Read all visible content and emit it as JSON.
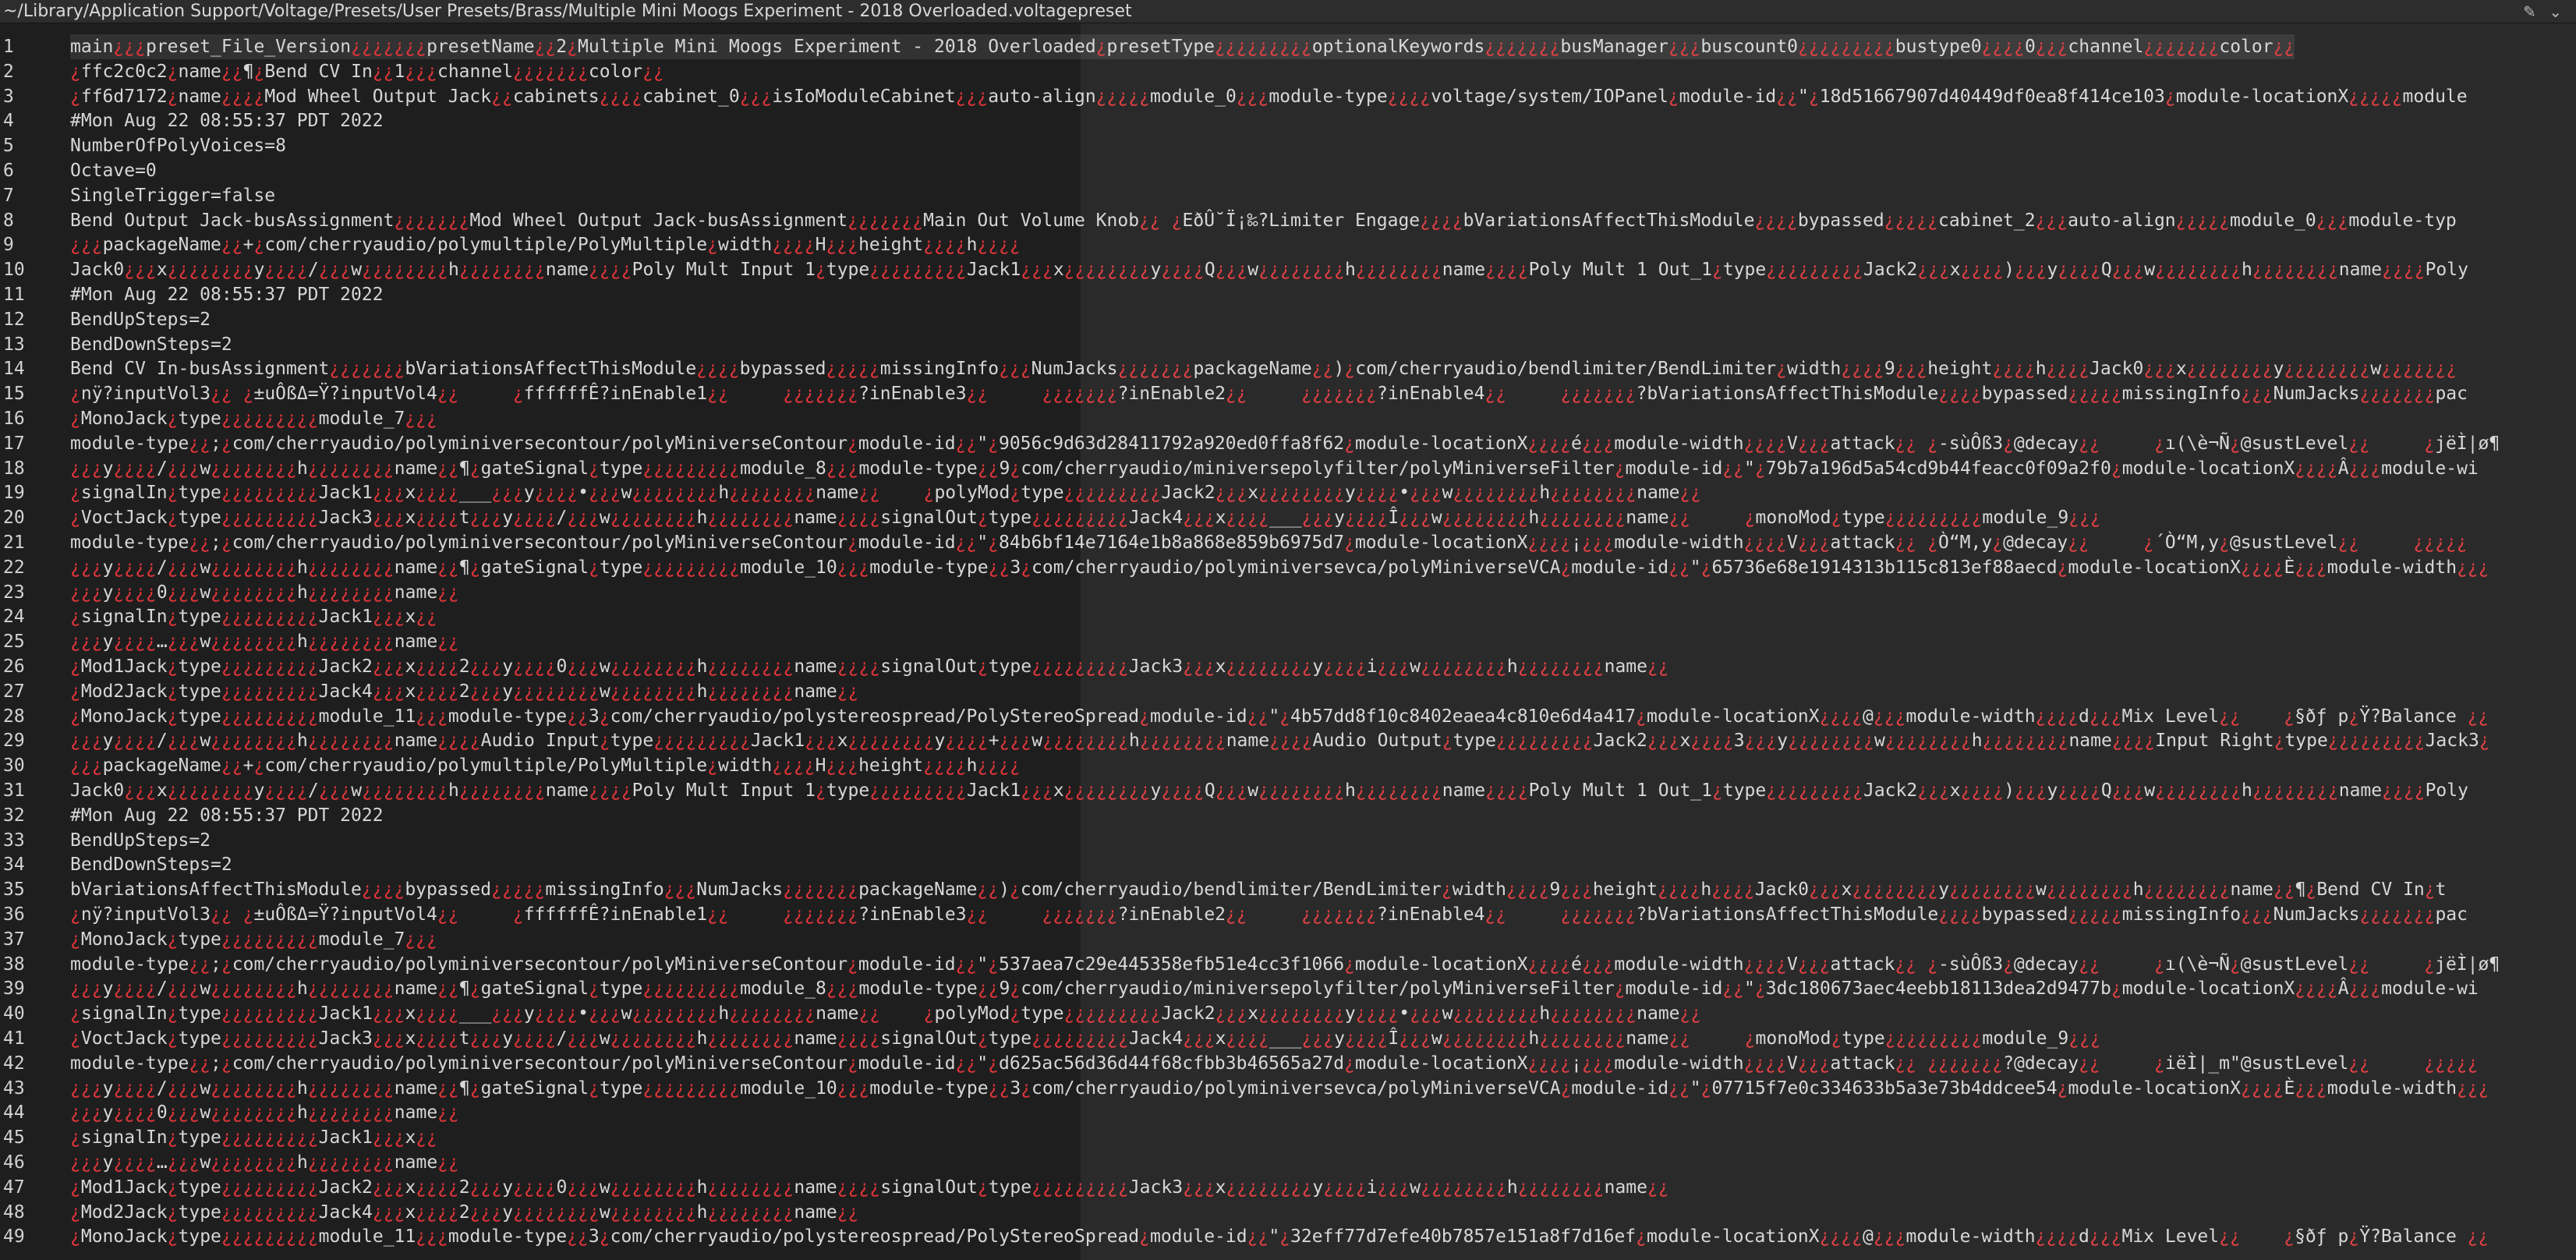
{
  "window": {
    "title": "~/Library/Application Support/Voltage/Presets/User Presets/Brass/Multiple Mini Moogs Experiment - 2018 Overloaded.voltagepreset",
    "icons": [
      "pen-icon",
      "chevron-down-icon"
    ]
  },
  "colors": {
    "background": "#1e1e1e",
    "text": "#d6d6d6",
    "control_char": "#e0353a"
  },
  "lines": [
    "main¿¿¿preset_File_Version¿¿¿¿¿¿¿presetName¿¿2¿Multiple Mini Moogs Experiment - 2018 Overloaded¿presetType¿¿¿¿¿¿¿¿¿optionalKeywords¿¿¿¿¿¿¿busManager¿¿¿buscount0¿¿¿¿¿¿¿¿¿bustype0¿¿¿¿0¿¿¿channel¿¿¿¿¿¿¿color¿¿",
    "¿ffc2c0c2¿name¿¿¶¿Bend CV In¿¿1¿¿¿channel¿¿¿¿¿¿¿color¿¿",
    "¿ff6d7172¿name¿¿¿¿Mod Wheel Output Jack¿¿cabinets¿¿¿¿cabinet_0¿¿¿isIoModuleCabinet¿¿¿auto-align¿¿¿¿¿module_0¿¿¿module-type¿¿¿¿voltage/system/IOPanel¿module-id¿¿\"¿18d51667907d40449df0ea8f414ce103¿module-locationX¿¿¿¿¿module",
    "#Mon Aug 22 08:55:37 PDT 2022",
    "NumberOfPolyVoices=8",
    "Octave=0",
    "SingleTrigger=false",
    "Bend Output Jack-busAssignment¿¿¿¿¿¿¿Mod Wheel Output Jack-busAssignment¿¿¿¿¿¿¿Main Out Volume Knob¿¿ ¿EðÛ˘Ï¡‰?Limiter Engage¿¿¿¿bVariationsAffectThisModule¿¿¿¿bypassed¿¿¿¿¿cabinet_2¿¿¿auto-align¿¿¿¿¿module_0¿¿¿module-typ",
    "¿¿¿packageName¿¿+¿com/cherryaudio/polymultiple/PolyMultiple¿width¿¿¿¿H¿¿¿height¿¿¿¿h¿¿¿¿",
    "Jack0¿¿¿x¿¿¿¿¿¿¿¿y¿¿¿¿/¿¿¿w¿¿¿¿¿¿¿¿h¿¿¿¿¿¿¿¿name¿¿¿¿Poly Mult Input 1¿type¿¿¿¿¿¿¿¿¿Jack1¿¿¿x¿¿¿¿¿¿¿¿y¿¿¿¿Q¿¿¿w¿¿¿¿¿¿¿¿h¿¿¿¿¿¿¿¿name¿¿¿¿Poly Mult 1 Out_1¿type¿¿¿¿¿¿¿¿¿Jack2¿¿¿x¿¿¿¿)¿¿¿y¿¿¿¿Q¿¿¿w¿¿¿¿¿¿¿¿h¿¿¿¿¿¿¿¿name¿¿¿¿Poly",
    "#Mon Aug 22 08:55:37 PDT 2022",
    "BendUpSteps=2",
    "BendDownSteps=2",
    "Bend CV In-busAssignment¿¿¿¿¿¿¿bVariationsAffectThisModule¿¿¿¿bypassed¿¿¿¿¿missingInfo¿¿¿NumJacks¿¿¿¿¿¿¿packageName¿¿)¿com/cherryaudio/bendlimiter/BendLimiter¿width¿¿¿¿9¿¿¿height¿¿¿¿h¿¿¿¿Jack0¿¿¿x¿¿¿¿¿¿¿¿y¿¿¿¿¿¿¿¿w¿¿¿¿¿¿¿",
    "¿nÿ?inputVol3¿¿ ¿±uÔßΔ=Ÿ?inputVol4¿¿     ¿ffffffÊ?inEnable1¿¿     ¿¿¿¿¿¿¿?inEnable3¿¿     ¿¿¿¿¿¿¿?inEnable2¿¿     ¿¿¿¿¿¿¿?inEnable4¿¿     ¿¿¿¿¿¿¿?bVariationsAffectThisModule¿¿¿¿bypassed¿¿¿¿¿missingInfo¿¿¿NumJacks¿¿¿¿¿¿¿pac",
    "¿MonoJack¿type¿¿¿¿¿¿¿¿¿module_7¿¿¿",
    "module-type¿¿;¿com/cherryaudio/polyminiversecontour/polyMiniverseContour¿module-id¿¿\"¿9056c9d63d28411792a920ed0ffa8f62¿module-locationX¿¿¿¿é¿¿¿module-width¿¿¿¿V¿¿¿attack¿¿ ¿-sùÔß3¿@decay¿¿     ¿ı(\\è¬Ñ¿@sustLevel¿¿     ¿jëÌ|ø¶",
    "¿¿¿y¿¿¿¿/¿¿¿w¿¿¿¿¿¿¿¿h¿¿¿¿¿¿¿¿name¿¿¶¿gateSignal¿type¿¿¿¿¿¿¿¿¿module_8¿¿¿module-type¿¿9¿com/cherryaudio/miniversepolyfilter/polyMiniverseFilter¿module-id¿¿\"¿79b7a196d5a54cd9b44feacc0f09a2f0¿module-locationX¿¿¿¿Â¿¿¿module-wi",
    "¿signalIn¿type¿¿¿¿¿¿¿¿¿Jack1¿¿¿x¿¿¿¿___¿¿¿y¿¿¿¿•¿¿¿w¿¿¿¿¿¿¿¿h¿¿¿¿¿¿¿¿name¿¿    ¿polyMod¿type¿¿¿¿¿¿¿¿¿Jack2¿¿¿x¿¿¿¿¿¿¿¿y¿¿¿¿•¿¿¿w¿¿¿¿¿¿¿¿h¿¿¿¿¿¿¿¿name¿¿",
    "¿VoctJack¿type¿¿¿¿¿¿¿¿¿Jack3¿¿¿x¿¿¿¿t¿¿¿y¿¿¿¿/¿¿¿w¿¿¿¿¿¿¿¿h¿¿¿¿¿¿¿¿name¿¿¿¿signalOut¿type¿¿¿¿¿¿¿¿¿Jack4¿¿¿x¿¿¿¿___¿¿¿y¿¿¿¿Î¿¿¿w¿¿¿¿¿¿¿¿h¿¿¿¿¿¿¿¿name¿¿     ¿monoMod¿type¿¿¿¿¿¿¿¿¿module_9¿¿¿",
    "module-type¿¿;¿com/cherryaudio/polyminiversecontour/polyMiniverseContour¿module-id¿¿\"¿84b6bf14e7164e1b8a868e859b6975d7¿module-locationX¿¿¿¿¡¿¿¿module-width¿¿¿¿V¿¿¿attack¿¿ ¿Ò“M,y¿@decay¿¿     ¿´Ò“M,y¿@sustLevel¿¿     ¿¿¿¿¿",
    "¿¿¿y¿¿¿¿/¿¿¿w¿¿¿¿¿¿¿¿h¿¿¿¿¿¿¿¿name¿¿¶¿gateSignal¿type¿¿¿¿¿¿¿¿¿module_10¿¿¿module-type¿¿3¿com/cherryaudio/polyminiversevca/polyMiniverseVCA¿module-id¿¿\"¿65736e68e1914313b115c813ef88aecd¿module-locationX¿¿¿¿È¿¿¿module-width¿¿¿",
    "¿¿¿y¿¿¿¿0¿¿¿w¿¿¿¿¿¿¿¿h¿¿¿¿¿¿¿¿name¿¿",
    "¿signalIn¿type¿¿¿¿¿¿¿¿¿Jack1¿¿¿x¿¿",
    "¿¿¿y¿¿¿¿…¿¿¿w¿¿¿¿¿¿¿¿h¿¿¿¿¿¿¿¿name¿¿",
    "¿Mod1Jack¿type¿¿¿¿¿¿¿¿¿Jack2¿¿¿x¿¿¿¿2¿¿¿y¿¿¿¿0¿¿¿w¿¿¿¿¿¿¿¿h¿¿¿¿¿¿¿¿name¿¿¿¿signalOut¿type¿¿¿¿¿¿¿¿¿Jack3¿¿¿x¿¿¿¿¿¿¿¿y¿¿¿¿i¿¿¿w¿¿¿¿¿¿¿¿h¿¿¿¿¿¿¿¿name¿¿",
    "¿Mod2Jack¿type¿¿¿¿¿¿¿¿¿Jack4¿¿¿x¿¿¿¿2¿¿¿y¿¿¿¿¿¿¿¿w¿¿¿¿¿¿¿¿h¿¿¿¿¿¿¿¿name¿¿",
    "¿MonoJack¿type¿¿¿¿¿¿¿¿¿module_11¿¿¿module-type¿¿3¿com/cherryaudio/polystereospread/PolyStereoSpread¿module-id¿¿\"¿4b57dd8f10c8402eaea4c810e6d4a417¿module-locationX¿¿¿¿@¿¿¿module-width¿¿¿¿d¿¿¿Mix Level¿¿    ¿§ðƒ p¿Ÿ?Balance ¿¿",
    "¿¿¿y¿¿¿¿/¿¿¿w¿¿¿¿¿¿¿¿h¿¿¿¿¿¿¿¿name¿¿¿¿Audio Input¿type¿¿¿¿¿¿¿¿¿Jack1¿¿¿x¿¿¿¿¿¿¿¿y¿¿¿¿+¿¿¿w¿¿¿¿¿¿¿¿h¿¿¿¿¿¿¿¿name¿¿¿¿Audio Output¿type¿¿¿¿¿¿¿¿¿Jack2¿¿¿x¿¿¿¿3¿¿¿y¿¿¿¿¿¿¿¿w¿¿¿¿¿¿¿¿h¿¿¿¿¿¿¿¿name¿¿¿¿Input Right¿type¿¿¿¿¿¿¿¿¿Jack3¿",
    "¿¿¿packageName¿¿+¿com/cherryaudio/polymultiple/PolyMultiple¿width¿¿¿¿H¿¿¿height¿¿¿¿h¿¿¿¿",
    "Jack0¿¿¿x¿¿¿¿¿¿¿¿y¿¿¿¿/¿¿¿w¿¿¿¿¿¿¿¿h¿¿¿¿¿¿¿¿name¿¿¿¿Poly Mult Input 1¿type¿¿¿¿¿¿¿¿¿Jack1¿¿¿x¿¿¿¿¿¿¿¿y¿¿¿¿Q¿¿¿w¿¿¿¿¿¿¿¿h¿¿¿¿¿¿¿¿name¿¿¿¿Poly Mult 1 Out_1¿type¿¿¿¿¿¿¿¿¿Jack2¿¿¿x¿¿¿¿)¿¿¿y¿¿¿¿Q¿¿¿w¿¿¿¿¿¿¿¿h¿¿¿¿¿¿¿¿name¿¿¿¿Poly",
    "#Mon Aug 22 08:55:37 PDT 2022",
    "BendUpSteps=2",
    "BendDownSteps=2",
    "bVariationsAffectThisModule¿¿¿¿bypassed¿¿¿¿¿missingInfo¿¿¿NumJacks¿¿¿¿¿¿¿packageName¿¿)¿com/cherryaudio/bendlimiter/BendLimiter¿width¿¿¿¿9¿¿¿height¿¿¿¿h¿¿¿¿Jack0¿¿¿x¿¿¿¿¿¿¿¿y¿¿¿¿¿¿¿¿w¿¿¿¿¿¿¿¿h¿¿¿¿¿¿¿¿name¿¿¶¿Bend CV In¿t",
    "¿nÿ?inputVol3¿¿ ¿±uÔßΔ=Ÿ?inputVol4¿¿     ¿ffffffÊ?inEnable1¿¿     ¿¿¿¿¿¿¿?inEnable3¿¿     ¿¿¿¿¿¿¿?inEnable2¿¿     ¿¿¿¿¿¿¿?inEnable4¿¿     ¿¿¿¿¿¿¿?bVariationsAffectThisModule¿¿¿¿bypassed¿¿¿¿¿missingInfo¿¿¿NumJacks¿¿¿¿¿¿¿pac",
    "¿MonoJack¿type¿¿¿¿¿¿¿¿¿module_7¿¿¿",
    "module-type¿¿;¿com/cherryaudio/polyminiversecontour/polyMiniverseContour¿module-id¿¿\"¿537aea7c29e445358efb51e4cc3f1066¿module-locationX¿¿¿¿é¿¿¿module-width¿¿¿¿V¿¿¿attack¿¿ ¿-sùÔß3¿@decay¿¿     ¿ı(\\è¬Ñ¿@sustLevel¿¿     ¿jëÌ|ø¶",
    "¿¿¿y¿¿¿¿/¿¿¿w¿¿¿¿¿¿¿¿h¿¿¿¿¿¿¿¿name¿¿¶¿gateSignal¿type¿¿¿¿¿¿¿¿¿module_8¿¿¿module-type¿¿9¿com/cherryaudio/miniversepolyfilter/polyMiniverseFilter¿module-id¿¿\"¿3dc180673aec4eebb18113dea2d9477b¿module-locationX¿¿¿¿Â¿¿¿module-wi",
    "¿signalIn¿type¿¿¿¿¿¿¿¿¿Jack1¿¿¿x¿¿¿¿___¿¿¿y¿¿¿¿•¿¿¿w¿¿¿¿¿¿¿¿h¿¿¿¿¿¿¿¿name¿¿    ¿polyMod¿type¿¿¿¿¿¿¿¿¿Jack2¿¿¿x¿¿¿¿¿¿¿¿y¿¿¿¿•¿¿¿w¿¿¿¿¿¿¿¿h¿¿¿¿¿¿¿¿name¿¿",
    "¿VoctJack¿type¿¿¿¿¿¿¿¿¿Jack3¿¿¿x¿¿¿¿t¿¿¿y¿¿¿¿/¿¿¿w¿¿¿¿¿¿¿¿h¿¿¿¿¿¿¿¿name¿¿¿¿signalOut¿type¿¿¿¿¿¿¿¿¿Jack4¿¿¿x¿¿¿¿___¿¿¿y¿¿¿¿Î¿¿¿w¿¿¿¿¿¿¿¿h¿¿¿¿¿¿¿¿name¿¿     ¿monoMod¿type¿¿¿¿¿¿¿¿¿module_9¿¿¿",
    "module-type¿¿;¿com/cherryaudio/polyminiversecontour/polyMiniverseContour¿module-id¿¿\"¿d625ac56d36d44f68cfbb3b46565a27d¿module-locationX¿¿¿¿¡¿¿¿module-width¿¿¿¿V¿¿¿attack¿¿ ¿¿¿¿¿¿¿?@decay¿¿     ¿iëÌ|_m\"@sustLevel¿¿     ¿¿¿¿¿",
    "¿¿¿y¿¿¿¿/¿¿¿w¿¿¿¿¿¿¿¿h¿¿¿¿¿¿¿¿name¿¿¶¿gateSignal¿type¿¿¿¿¿¿¿¿¿module_10¿¿¿module-type¿¿3¿com/cherryaudio/polyminiversevca/polyMiniverseVCA¿module-id¿¿\"¿07715f7e0c334633b5a3e73b4ddcee54¿module-locationX¿¿¿¿È¿¿¿module-width¿¿¿",
    "¿¿¿y¿¿¿¿0¿¿¿w¿¿¿¿¿¿¿¿h¿¿¿¿¿¿¿¿name¿¿",
    "¿signalIn¿type¿¿¿¿¿¿¿¿¿Jack1¿¿¿x¿¿",
    "¿¿¿y¿¿¿¿…¿¿¿w¿¿¿¿¿¿¿¿h¿¿¿¿¿¿¿¿name¿¿",
    "¿Mod1Jack¿type¿¿¿¿¿¿¿¿¿Jack2¿¿¿x¿¿¿¿2¿¿¿y¿¿¿¿0¿¿¿w¿¿¿¿¿¿¿¿h¿¿¿¿¿¿¿¿name¿¿¿¿signalOut¿type¿¿¿¿¿¿¿¿¿Jack3¿¿¿x¿¿¿¿¿¿¿¿y¿¿¿¿i¿¿¿w¿¿¿¿¿¿¿¿h¿¿¿¿¿¿¿¿name¿¿",
    "¿Mod2Jack¿type¿¿¿¿¿¿¿¿¿Jack4¿¿¿x¿¿¿¿2¿¿¿y¿¿¿¿¿¿¿¿w¿¿¿¿¿¿¿¿h¿¿¿¿¿¿¿¿name¿¿",
    "¿MonoJack¿type¿¿¿¿¿¿¿¿¿module_11¿¿¿module-type¿¿3¿com/cherryaudio/polystereospread/PolyStereoSpread¿module-id¿¿\"¿32eff77d7efe40b7857e151a8f7d16ef¿module-locationX¿¿¿¿@¿¿¿module-width¿¿¿¿d¿¿¿Mix Level¿¿    ¿§ðƒ p¿Ÿ?Balance ¿¿"
  ]
}
